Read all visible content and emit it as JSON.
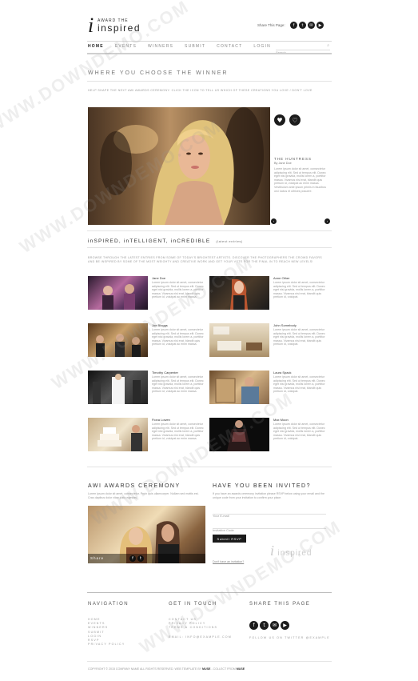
{
  "header": {
    "logo_top": "AWARD THE",
    "logo_main": "inspired",
    "share_label": "Share This Page:",
    "social_icons": [
      "facebook-icon",
      "twitter-icon",
      "email-icon",
      "youtube-icon"
    ]
  },
  "nav": {
    "items": [
      "HOME",
      "EVENTS",
      "WINNERS",
      "SUBMIT",
      "CONTACT",
      "LOGIN"
    ],
    "search_placeholder": "Search"
  },
  "choose": {
    "title": "WHERE YOU CHOOSE THE WINNER",
    "intro": "HELP SHAPE THE NEXT AWI AWARDS CEREMONY. CLICK THE ICON TO TELL US WHICH OF THESE CREATIONS YOU LOVE / DON'T LOVE"
  },
  "feature": {
    "title": "THE HUNTRESS",
    "author": "By Jane Doe",
    "text": "Lorem ipsum dolor sit amet, consectetur adipiscing elit. Sed ut tempus elit. Donec eget nisi gravida, mollis lorem a, porttitor massa. Vivamus nisi erat, blandit quis pretium id, volutpat ac enim massa. Vestibulum ante ipsum primis in faucibus orci luctus et ultrices posuere."
  },
  "section": {
    "title": "inSPIRED, inTELLIGENT, inCREDIBLE",
    "subtitle": "(latest entries)",
    "intro": "BROWSE THROUGH THE LATEST ENTRIES FROM SOME OF TODAY'S BRIGHTEST ARTISTS. DISCOVER THE PHOTOGRAPHERS THE CROWD FAVORS AND BE INSPIRED BY SOME OF THE MOST WEIGHTY AND CREATIVE WORK AND GET YOUR VOTE FOR THE FINAL IN TO REACH NEW LEVELS!"
  },
  "entries": [
    {
      "name": "Jane Doe",
      "text": "Lorem ipsum dolor sit amet, consectetur adipiscing elit. Sed ut tempus elit. Donec eget nisi gravida, mollis lorem a, porttitor massa. Vivamus nisi erat, blandit quis pretium id, volutpat ac enim massa."
    },
    {
      "name": "Anne Other",
      "text": "Lorem ipsum dolor sit amet, consectetur adipiscing elit. Sed ut tempus elit. Donec eget nisi gravida, mollis lorem a, porttitor massa. Vivamus nisi erat, blandit quis pretium id, volutpat."
    },
    {
      "name": "Joe Bloggs",
      "text": "Lorem ipsum dolor sit amet, consectetur adipiscing elit. Sed ut tempus elit. Donec eget nisi gravida, mollis lorem a, porttitor massa. Vivamus nisi erat, blandit quis pretium id, volutpat ac enim massa."
    },
    {
      "name": "John Somebody",
      "text": "Lorem ipsum dolor sit amet, consectetur adipiscing elit. Sed ut tempus elit. Donec eget nisi gravida, mollis lorem a, porttitor massa. Vivamus nisi erat, blandit quis pretium id, volutpat."
    },
    {
      "name": "Timothy Carpenter",
      "text": "Lorem ipsum dolor sit amet, consectetur adipiscing elit. Sed ut tempus elit. Donec eget nisi gravida, mollis lorem a, porttitor massa. Vivamus nisi erat, blandit quis pretium id, volutpat ac enim massa."
    },
    {
      "name": "Laura Spack",
      "text": "Lorem ipsum dolor sit amet, consectetur adipiscing elit. Sed ut tempus elit. Donec eget nisi gravida, mollis lorem a, porttitor massa. Vivamus nisi erat, blandit quis pretium id, volutpat."
    },
    {
      "name": "Fiona Lowen",
      "text": "Lorem ipsum dolor sit amet, consectetur adipiscing elit. Sed ut tempus elit. Donec eget nisi gravida, mollis lorem a, porttitor massa. Vivamus nisi erat, blandit quis pretium id, volutpat ac enim massa."
    },
    {
      "name": "Max Moon",
      "text": "Lorem ipsum dolor sit amet, consectetur adipiscing elit. Sed ut tempus elit. Donec eget nisi gravida, mollis lorem a, porttitor massa. Vivamus nisi erat, blandit quis pretium id, volutpat."
    }
  ],
  "ceremony": {
    "title": "AWI AWARDS CEREMONY",
    "text": "Lorem ipsum dolor sit amet, consectetur. Proin quis ullamcorper. Nullam sed mattis est. Cras dapibus dolor vitae justo egestas.",
    "share_label": "Share"
  },
  "invited": {
    "title": "HAVE YOU BEEN INVITED?",
    "text": "If you have an awards ceremony invitation please RSVP below using your email and the unique code from your invitation to confirm your place.",
    "email_placeholder": "Your E-mail",
    "code_placeholder": "Invitation Code",
    "submit_label": "Submit RSVP",
    "help_link": "Don't have an invitation?"
  },
  "footer": {
    "nav_title": "NAVIGATION",
    "nav_links": [
      "HOME",
      "EVENTS",
      "WINNERS",
      "SUBMIT",
      "LOGIN",
      "RSVP",
      "PRIVACY POLICY"
    ],
    "contact_title": "GET IN TOUCH",
    "contact_links": [
      "CONTACT US",
      "PRIVACY POLICY",
      "TERMS & CONDITIONS"
    ],
    "contact_email": "EMAIL: INFO@EXAMPLE.COM",
    "share_title": "SHARE THIS PAGE",
    "follow_text": "FOLLOW US ON TWITTER @EXAMPLE",
    "copyright": "COPYRIGHT © 2015 COMPANY NAME ALL RIGHTS RESERVED. WEB TEMPLATE BY",
    "copyright_brand1": "MUSE",
    "copyright_mid": "- COLLECT FROM",
    "copyright_brand2": "MUSE"
  },
  "watermark": "WWW.DOWNDEMO.COM"
}
